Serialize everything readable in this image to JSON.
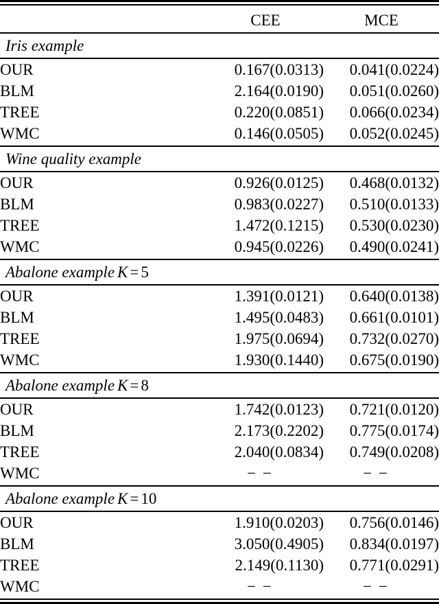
{
  "table": {
    "columns": [
      "",
      "CEE",
      "MCE"
    ],
    "method_column_header": "",
    "sections": [
      {
        "title": "Iris example",
        "title_math": null,
        "rows": [
          {
            "method": "OUR",
            "CEE": "0.167(0.0313)",
            "MCE": "0.041(0.0224)"
          },
          {
            "method": "BLM",
            "CEE": "2.164(0.0190)",
            "MCE": "0.051(0.0260)"
          },
          {
            "method": "TREE",
            "CEE": "0.220(0.0851)",
            "MCE": "0.066(0.0234)"
          },
          {
            "method": "WMC",
            "CEE": "0.146(0.0505)",
            "MCE": "0.052(0.0245)"
          }
        ]
      },
      {
        "title": "Wine quality example",
        "title_math": null,
        "rows": [
          {
            "method": "OUR",
            "CEE": "0.926(0.0125)",
            "MCE": "0.468(0.0132)"
          },
          {
            "method": "BLM",
            "CEE": "0.983(0.0227)",
            "MCE": "0.510(0.0133)"
          },
          {
            "method": "TREE",
            "CEE": "1.472(0.1215)",
            "MCE": "0.530(0.0230)"
          },
          {
            "method": "WMC",
            "CEE": "0.945(0.0226)",
            "MCE": "0.490(0.0241)"
          }
        ]
      },
      {
        "title": "Abalone example",
        "title_math": {
          "variable": "K",
          "operator": "=",
          "value": "5"
        },
        "rows": [
          {
            "method": "OUR",
            "CEE": "1.391(0.0121)",
            "MCE": "0.640(0.0138)"
          },
          {
            "method": "BLM",
            "CEE": "1.495(0.0483)",
            "MCE": "0.661(0.0101)"
          },
          {
            "method": "TREE",
            "CEE": "1.975(0.0694)",
            "MCE": "0.732(0.0270)"
          },
          {
            "method": "WMC",
            "CEE": "1.930(0.1440)",
            "MCE": "0.675(0.0190)"
          }
        ]
      },
      {
        "title": "Abalone example",
        "title_math": {
          "variable": "K",
          "operator": "=",
          "value": "8"
        },
        "rows": [
          {
            "method": "OUR",
            "CEE": "1.742(0.0123)",
            "MCE": "0.721(0.0120)"
          },
          {
            "method": "BLM",
            "CEE": "2.173(0.2202)",
            "MCE": "0.775(0.0174)"
          },
          {
            "method": "TREE",
            "CEE": "2.040(0.0834)",
            "MCE": "0.749(0.0208)"
          },
          {
            "method": "WMC",
            "CEE": "− −",
            "MCE": "− −"
          }
        ]
      },
      {
        "title": "Abalone example",
        "title_math": {
          "variable": "K",
          "operator": "=",
          "value": "10"
        },
        "rows": [
          {
            "method": "OUR",
            "CEE": "1.910(0.0203)",
            "MCE": "0.756(0.0146)"
          },
          {
            "method": "BLM",
            "CEE": "3.050(0.4905)",
            "MCE": "0.834(0.0197)"
          },
          {
            "method": "TREE",
            "CEE": "2.149(0.1130)",
            "MCE": "0.771(0.0291)"
          },
          {
            "method": "WMC",
            "CEE": "− −",
            "MCE": "− −"
          }
        ]
      }
    ]
  },
  "style": {
    "text_color": "#000000",
    "background_color": "#ffffff",
    "rule_color": "#000000"
  }
}
